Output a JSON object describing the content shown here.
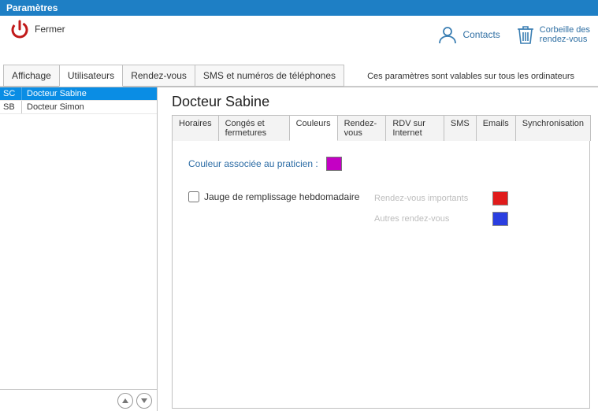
{
  "window": {
    "title": "Paramètres"
  },
  "toolbar": {
    "close_label": "Fermer",
    "contacts_label": "Contacts",
    "trash_label_1": "Corbeille des",
    "trash_label_2": "rendez-vous",
    "subnote": "Ces paramètres sont valables sur tous les ordinateurs"
  },
  "tabs": {
    "items": [
      {
        "label": "Affichage",
        "active": false
      },
      {
        "label": "Utilisateurs",
        "active": true
      },
      {
        "label": "Rendez-vous",
        "active": false
      },
      {
        "label": "SMS et numéros de téléphones",
        "active": false
      }
    ]
  },
  "users": [
    {
      "code": "SC",
      "name": "Docteur Sabine",
      "selected": true
    },
    {
      "code": "SB",
      "name": "Docteur Simon",
      "selected": false
    }
  ],
  "content": {
    "title": "Docteur Sabine",
    "subtabs": [
      {
        "label": "Horaires",
        "active": false
      },
      {
        "label": "Congés et fermetures",
        "active": false
      },
      {
        "label": "Couleurs",
        "active": true
      },
      {
        "label": "Rendez-vous",
        "active": false
      },
      {
        "label": "RDV sur Internet",
        "active": false
      },
      {
        "label": "SMS",
        "active": false
      },
      {
        "label": "Emails",
        "active": false
      },
      {
        "label": "Synchronisation",
        "active": false
      }
    ],
    "color_label": "Couleur associée au praticien :",
    "color_value": "#c400c4",
    "jauge_label": "Jauge de remplissage hebdomadaire",
    "jauge_checked": false,
    "legend": [
      {
        "label": "Rendez-vous importants",
        "color": "#e01b1b"
      },
      {
        "label": "Autres rendez-vous",
        "color": "#2a3ee0"
      }
    ]
  }
}
